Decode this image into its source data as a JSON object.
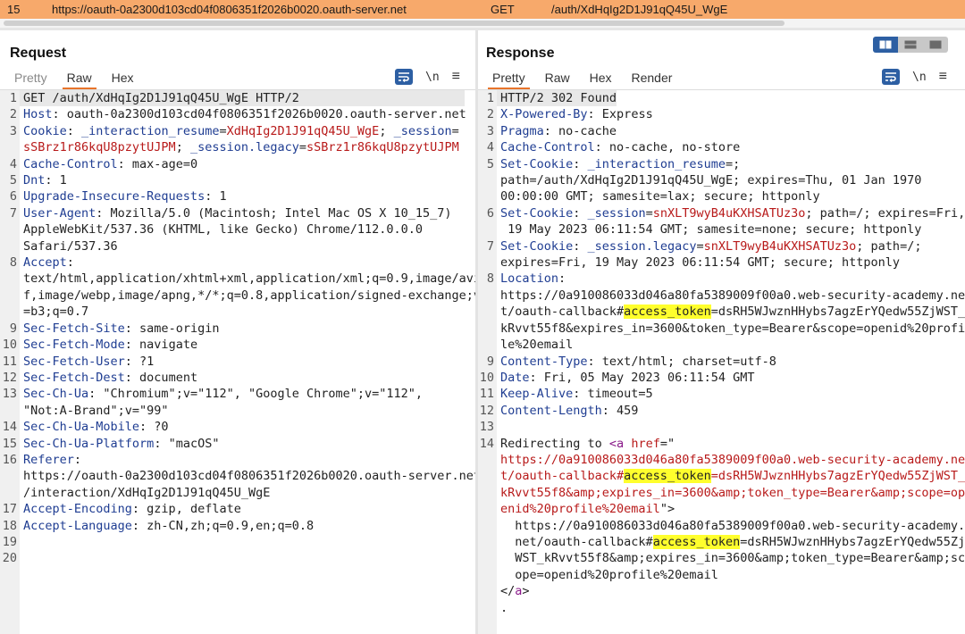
{
  "history": {
    "num": "15",
    "host": "https://oauth-0a2300d103cd04f0806351f2026b0020.oauth-server.net",
    "method": "GET",
    "path": "/auth/XdHqIg2D1J91qQ45U_WgE"
  },
  "request": {
    "title": "Request",
    "tabs": [
      "Pretty",
      "Raw",
      "Hex"
    ],
    "lines": [
      {
        "n": "1",
        "parts": [
          [
            "v",
            "GET /auth/XdHqIg2D1J91qQ45U_WgE HTTP/2"
          ]
        ]
      },
      {
        "n": "2",
        "parts": [
          [
            "k",
            "Host"
          ],
          [
            "v",
            ": oauth-0a2300d103cd04f0806351f2026b0020.oauth-server.net"
          ]
        ]
      },
      {
        "n": "3",
        "parts": [
          [
            "k",
            "Cookie"
          ],
          [
            "v",
            ": "
          ],
          [
            "k",
            "_interaction_resume"
          ],
          [
            "v",
            "="
          ],
          [
            "r",
            "XdHqIg2D1J91qQ45U_WgE"
          ],
          [
            "v",
            "; "
          ],
          [
            "k",
            "_session"
          ],
          [
            "v",
            "="
          ]
        ]
      },
      {
        "n": "",
        "parts": [
          [
            "r",
            "sSBrz1r86kqU8pzytUJPM"
          ],
          [
            "v",
            "; "
          ],
          [
            "k",
            "_session.legacy"
          ],
          [
            "v",
            "="
          ],
          [
            "r",
            "sSBrz1r86kqU8pzytUJPM"
          ]
        ]
      },
      {
        "n": "4",
        "parts": [
          [
            "k",
            "Cache-Control"
          ],
          [
            "v",
            ": max-age=0"
          ]
        ]
      },
      {
        "n": "5",
        "parts": [
          [
            "k",
            "Dnt"
          ],
          [
            "v",
            ": 1"
          ]
        ]
      },
      {
        "n": "6",
        "parts": [
          [
            "k",
            "Upgrade-Insecure-Requests"
          ],
          [
            "v",
            ": 1"
          ]
        ]
      },
      {
        "n": "7",
        "parts": [
          [
            "k",
            "User-Agent"
          ],
          [
            "v",
            ": Mozilla/5.0 (Macintosh; Intel Mac OS X 10_15_7)"
          ]
        ]
      },
      {
        "n": "",
        "parts": [
          [
            "v",
            "AppleWebKit/537.36 (KHTML, like Gecko) Chrome/112.0.0.0"
          ]
        ]
      },
      {
        "n": "",
        "parts": [
          [
            "v",
            "Safari/537.36"
          ]
        ]
      },
      {
        "n": "8",
        "parts": [
          [
            "k",
            "Accept"
          ],
          [
            "v",
            ":"
          ]
        ]
      },
      {
        "n": "",
        "parts": [
          [
            "v",
            "text/html,application/xhtml+xml,application/xml;q=0.9,image/avi"
          ]
        ]
      },
      {
        "n": "",
        "parts": [
          [
            "v",
            "f,image/webp,image/apng,*/*;q=0.8,application/signed-exchange;v"
          ]
        ]
      },
      {
        "n": "",
        "parts": [
          [
            "v",
            "=b3;q=0.7"
          ]
        ]
      },
      {
        "n": "9",
        "parts": [
          [
            "k",
            "Sec-Fetch-Site"
          ],
          [
            "v",
            ": same-origin"
          ]
        ]
      },
      {
        "n": "10",
        "parts": [
          [
            "k",
            "Sec-Fetch-Mode"
          ],
          [
            "v",
            ": navigate"
          ]
        ]
      },
      {
        "n": "11",
        "parts": [
          [
            "k",
            "Sec-Fetch-User"
          ],
          [
            "v",
            ": ?1"
          ]
        ]
      },
      {
        "n": "12",
        "parts": [
          [
            "k",
            "Sec-Fetch-Dest"
          ],
          [
            "v",
            ": document"
          ]
        ]
      },
      {
        "n": "13",
        "parts": [
          [
            "k",
            "Sec-Ch-Ua"
          ],
          [
            "v",
            ": \"Chromium\";v=\"112\", \"Google Chrome\";v=\"112\","
          ]
        ]
      },
      {
        "n": "",
        "parts": [
          [
            "v",
            "\"Not:A-Brand\";v=\"99\""
          ]
        ]
      },
      {
        "n": "14",
        "parts": [
          [
            "k",
            "Sec-Ch-Ua-Mobile"
          ],
          [
            "v",
            ": ?0"
          ]
        ]
      },
      {
        "n": "15",
        "parts": [
          [
            "k",
            "Sec-Ch-Ua-Platform"
          ],
          [
            "v",
            ": \"macOS\""
          ]
        ]
      },
      {
        "n": "16",
        "parts": [
          [
            "k",
            "Referer"
          ],
          [
            "v",
            ":"
          ]
        ]
      },
      {
        "n": "",
        "parts": [
          [
            "v",
            "https://oauth-0a2300d103cd04f0806351f2026b0020.oauth-server.net"
          ]
        ]
      },
      {
        "n": "",
        "parts": [
          [
            "v",
            "/interaction/XdHqIg2D1J91qQ45U_WgE"
          ]
        ]
      },
      {
        "n": "17",
        "parts": [
          [
            "k",
            "Accept-Encoding"
          ],
          [
            "v",
            ": gzip, deflate"
          ]
        ]
      },
      {
        "n": "18",
        "parts": [
          [
            "k",
            "Accept-Language"
          ],
          [
            "v",
            ": zh-CN,zh;q=0.9,en;q=0.8"
          ]
        ]
      },
      {
        "n": "19",
        "parts": []
      },
      {
        "n": "20",
        "parts": []
      }
    ]
  },
  "response": {
    "title": "Response",
    "tabs": [
      "Pretty",
      "Raw",
      "Hex",
      "Render"
    ],
    "lines": [
      {
        "n": "1",
        "parts": [
          [
            "v",
            "HTTP/2 302 Found"
          ]
        ]
      },
      {
        "n": "2",
        "parts": [
          [
            "k",
            "X-Powered-By"
          ],
          [
            "v",
            ": Express"
          ]
        ]
      },
      {
        "n": "3",
        "parts": [
          [
            "k",
            "Pragma"
          ],
          [
            "v",
            ": no-cache"
          ]
        ]
      },
      {
        "n": "4",
        "parts": [
          [
            "k",
            "Cache-Control"
          ],
          [
            "v",
            ": no-cache, no-store"
          ]
        ]
      },
      {
        "n": "5",
        "parts": [
          [
            "k",
            "Set-Cookie"
          ],
          [
            "v",
            ": "
          ],
          [
            "k",
            "_interaction_resume"
          ],
          [
            "v",
            "=;"
          ]
        ]
      },
      {
        "n": "",
        "parts": [
          [
            "v",
            "path=/auth/XdHqIg2D1J91qQ45U_WgE; expires=Thu, 01 Jan 1970"
          ]
        ]
      },
      {
        "n": "",
        "parts": [
          [
            "v",
            "00:00:00 GMT; samesite=lax; secure; httponly"
          ]
        ]
      },
      {
        "n": "6",
        "parts": [
          [
            "k",
            "Set-Cookie"
          ],
          [
            "v",
            ": "
          ],
          [
            "k",
            "_session"
          ],
          [
            "v",
            "="
          ],
          [
            "r",
            "snXLT9wyB4uKXHSATUz3o"
          ],
          [
            "v",
            "; path=/; expires=Fri,"
          ]
        ]
      },
      {
        "n": "",
        "parts": [
          [
            "v",
            " 19 May 2023 06:11:54 GMT; samesite=none; secure; httponly"
          ]
        ]
      },
      {
        "n": "7",
        "parts": [
          [
            "k",
            "Set-Cookie"
          ],
          [
            "v",
            ": "
          ],
          [
            "k",
            "_session.legacy"
          ],
          [
            "v",
            "="
          ],
          [
            "r",
            "snXLT9wyB4uKXHSATUz3o"
          ],
          [
            "v",
            "; path=/;"
          ]
        ]
      },
      {
        "n": "",
        "parts": [
          [
            "v",
            "expires=Fri, 19 May 2023 06:11:54 GMT; secure; httponly"
          ]
        ]
      },
      {
        "n": "8",
        "parts": [
          [
            "k",
            "Location"
          ],
          [
            "v",
            ":"
          ]
        ]
      },
      {
        "n": "",
        "parts": [
          [
            "v",
            "https://0a910086033d046a80fa5389009f00a0.web-security-academy.ne"
          ]
        ]
      },
      {
        "n": "",
        "parts": [
          [
            "v",
            "t/oauth-callback#"
          ],
          [
            "hl",
            "access_token"
          ],
          [
            "v",
            "=dsRH5WJwznHHybs7agzErYQedw55ZjWST_"
          ]
        ]
      },
      {
        "n": "",
        "parts": [
          [
            "v",
            "kRvvt55f8&expires_in=3600&token_type=Bearer&scope=openid%20profi"
          ]
        ]
      },
      {
        "n": "",
        "parts": [
          [
            "v",
            "le%20email"
          ]
        ]
      },
      {
        "n": "9",
        "parts": [
          [
            "k",
            "Content-Type"
          ],
          [
            "v",
            ": text/html; charset=utf-8"
          ]
        ]
      },
      {
        "n": "10",
        "parts": [
          [
            "k",
            "Date"
          ],
          [
            "v",
            ": Fri, 05 May 2023 06:11:54 GMT"
          ]
        ]
      },
      {
        "n": "11",
        "parts": [
          [
            "k",
            "Keep-Alive"
          ],
          [
            "v",
            ": timeout=5"
          ]
        ]
      },
      {
        "n": "12",
        "parts": [
          [
            "k",
            "Content-Length"
          ],
          [
            "v",
            ": 459"
          ]
        ]
      },
      {
        "n": "13",
        "parts": []
      },
      {
        "n": "14",
        "parts": [
          [
            "v",
            "Redirecting to "
          ],
          [
            "tag",
            "<a"
          ],
          [
            "v",
            " "
          ],
          [
            "r",
            "href"
          ],
          [
            "v",
            "=\""
          ]
        ]
      },
      {
        "n": "",
        "parts": [
          [
            "r",
            "https://0a910086033d046a80fa5389009f00a0.web-security-academy.ne"
          ]
        ]
      },
      {
        "n": "",
        "parts": [
          [
            "r",
            "t/oauth-callback#"
          ],
          [
            "hl",
            "access_token"
          ],
          [
            "r",
            "=dsRH5WJwznHHybs7agzErYQedw55ZjWST_"
          ]
        ]
      },
      {
        "n": "",
        "parts": [
          [
            "r",
            "kRvvt55f8&amp;expires_in=3600&amp;token_type=Bearer&amp;scope=op"
          ]
        ]
      },
      {
        "n": "",
        "parts": [
          [
            "r",
            "enid%20profile%20email"
          ],
          [
            "v",
            "\">"
          ]
        ]
      },
      {
        "n": "",
        "parts": [
          [
            "v",
            "  https://0a910086033d046a80fa5389009f00a0.web-security-academy."
          ]
        ]
      },
      {
        "n": "",
        "parts": [
          [
            "v",
            "  net/oauth-callback#"
          ],
          [
            "hl",
            "access_token"
          ],
          [
            "v",
            "=dsRH5WJwznHHybs7agzErYQedw55Zj"
          ]
        ]
      },
      {
        "n": "",
        "parts": [
          [
            "v",
            "  WST_kRvvt55f8&amp;expires_in=3600&amp;token_type=Bearer&amp;sc"
          ]
        ]
      },
      {
        "n": "",
        "parts": [
          [
            "v",
            "  ope=openid%20profile%20email"
          ]
        ]
      },
      {
        "n": "",
        "parts": [
          [
            "v",
            "</"
          ],
          [
            "tag",
            "a"
          ],
          [
            "v",
            ">"
          ]
        ]
      },
      {
        "n": "",
        "parts": [
          [
            "v",
            "."
          ]
        ]
      }
    ]
  },
  "icons": {
    "wrap": "wrap-lines-icon",
    "newline": "\\n",
    "menu": "≡"
  }
}
